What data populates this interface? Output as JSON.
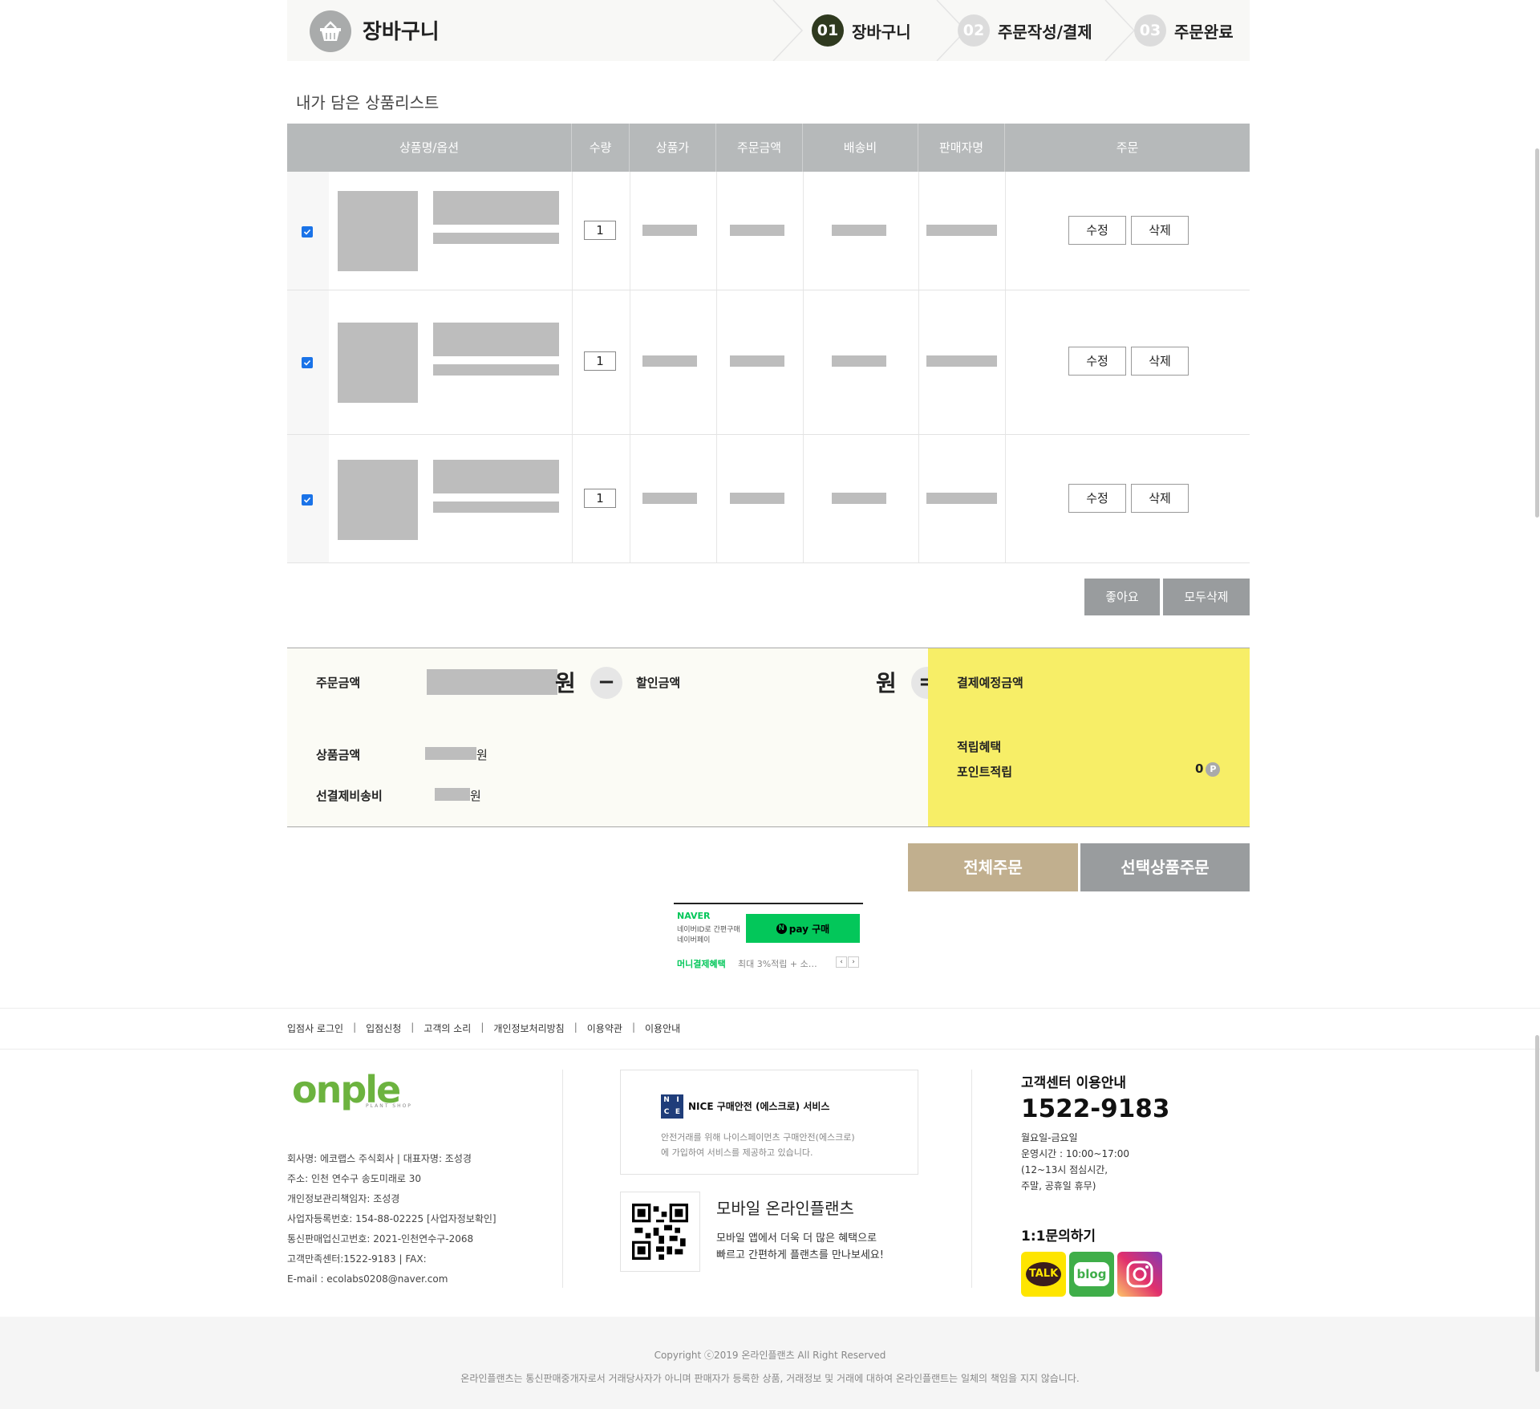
{
  "header": {
    "title": "장바구니",
    "steps": [
      {
        "num": "01",
        "label": "장바구니"
      },
      {
        "num": "02",
        "label": "주문작성/결제"
      },
      {
        "num": "03",
        "label": "주문완료"
      }
    ]
  },
  "list_title": "내가 담은 상품리스트",
  "table": {
    "headers": [
      "상품명/옵션",
      "수량",
      "상품가",
      "주문금액",
      "배송비",
      "판매자명",
      "주문"
    ],
    "rows": [
      {
        "qty": "1",
        "edit": "수정",
        "delete": "삭제"
      },
      {
        "qty": "1",
        "edit": "수정",
        "delete": "삭제"
      },
      {
        "qty": "1",
        "edit": "수정",
        "delete": "삭제"
      }
    ]
  },
  "actions": {
    "like": "좋아요",
    "delete_all": "모두삭제"
  },
  "summary": {
    "order_amount_label": "주문금액",
    "won": "원",
    "minus": "−",
    "discount_label": "할인금액",
    "equals": "=",
    "payment_label": "결제예정금액",
    "product_amount_label": "상품금액",
    "prepaid_shipping_label": "선결제비송비",
    "benefit_label": "적립혜택",
    "point_label": "포인트적립",
    "point_value": "0",
    "point_badge": "P"
  },
  "order_buttons": {
    "all": "전체주문",
    "selected": "선택상품주문"
  },
  "npay": {
    "brand": "NAVER",
    "line1": "네이버ID로 간편구매",
    "line2": "네이버페이",
    "button": "pay 구매",
    "benefit": "머니결제혜택",
    "benefit_desc": "최대 3%적립 + 소…"
  },
  "footer": {
    "links": [
      "입점사 로그인",
      "입점신청",
      "고객의 소리",
      "개인정보처리방침",
      "이용약관",
      "이용안내"
    ],
    "logo_text": "onple",
    "logo_sub": "PLANT SHOP",
    "company_lines": [
      "회사명: 에코랩스 주식회사  |  대표자명: 조성경",
      "주소: 인천 연수구 송도미래로 30",
      "개인정보관리책임자: 조성경",
      "사업자등록번호: 154-88-02225 [사업자정보확인]",
      "통신판매업신고번호: 2021-인천연수구-2068",
      "고객만족센터:1522-9183 |  FAX:",
      "E-mail : ecolabs0208@naver.com"
    ],
    "nice_title": "NICE 구매안전 (에스크로) 서비스",
    "nice_desc1": "안전거래를 위해 나이스페이먼츠 구매안전(에스크로)",
    "nice_desc2": "에 가입하여 서비스를 제공하고 있습니다.",
    "mobile_title": "모바일 온라인플랜츠",
    "mobile_desc1": "모바일 앱에서 더욱 더 많은 혜택으로",
    "mobile_desc2": "빠르고 간편하게 플랜츠를 만나보세요!",
    "cs_title": "고객센터 이용안내",
    "cs_phone": "1522-9183",
    "cs_hours": [
      "월요일-금요일",
      "운영시간 : 10:00~17:00",
      "(12~13시 점심시간,",
      "주말, 공휴일 휴무)"
    ],
    "inquiry_title": "1:1문의하기",
    "sns": {
      "talk": "TALK",
      "blog": "blog"
    },
    "copyright": "Copyright ⓒ2019 온라인플랜츠 All Right Reserved",
    "disclaimer": "온라인플랜츠는 통신판매중개자로서 거래당사자가 아니며 판매자가 등록한 상품, 거래정보 및 거래에 대하여 온라인플랜트는 일체의 책임을 지지 않습니다."
  },
  "colors": {
    "header_bg": "#b6b9ba",
    "summary_yellow": "#f7ee67",
    "order_all": "#c1af8e",
    "order_selected": "#999c9e",
    "step_active": "#2f3a1f",
    "npay_green": "#03c75a"
  }
}
